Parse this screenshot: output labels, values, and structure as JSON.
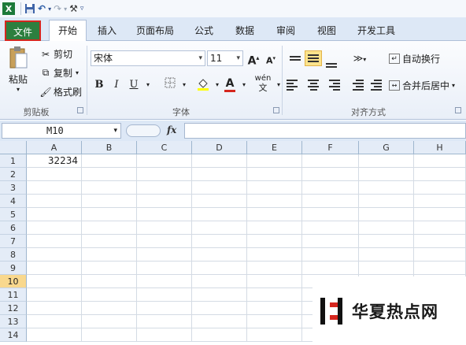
{
  "qat": {
    "app_icon": "X",
    "undo_glyph": "↶",
    "redo_glyph": "↷",
    "more_glyph": "▾",
    "custom_glyph": "⚒",
    "end_glyph": "▿"
  },
  "tabs": [
    "文件",
    "开始",
    "插入",
    "页面布局",
    "公式",
    "数据",
    "审阅",
    "视图",
    "开发工具"
  ],
  "clipboard": {
    "paste_label": "粘贴",
    "cut_label": "剪切",
    "copy_label": "复制",
    "format_painter_label": "格式刷",
    "group_label": "剪贴板"
  },
  "font": {
    "font_name": "宋体",
    "font_size": "11",
    "grow_label": "A",
    "shrink_label": "A",
    "bold": "B",
    "italic": "I",
    "underline": "U",
    "wen_label": "wén",
    "group_label": "字体"
  },
  "alignment": {
    "wrap_text_label": "自动换行",
    "merge_center_label": "合并后居中",
    "group_label": "对齐方式"
  },
  "formula_bar": {
    "name_box": "M10",
    "fx_label": "fx",
    "formula": ""
  },
  "sheet": {
    "columns": [
      "A",
      "B",
      "C",
      "D",
      "E",
      "F",
      "G",
      "H"
    ],
    "rows": [
      "1",
      "2",
      "3",
      "4",
      "5",
      "6",
      "7",
      "8",
      "9",
      "10",
      "11",
      "12",
      "13",
      "14"
    ],
    "active_row": "10",
    "cells": [
      {
        "ref": "A1",
        "value": "32234"
      }
    ]
  },
  "watermark": {
    "text": "华夏热点网"
  },
  "colors": {
    "file_tab": "#2d7f3f",
    "file_tab_border": "#d5261e",
    "active_row_header": "#f9d88d",
    "fill_color": "#ffff00",
    "font_color": "#d5261e"
  }
}
